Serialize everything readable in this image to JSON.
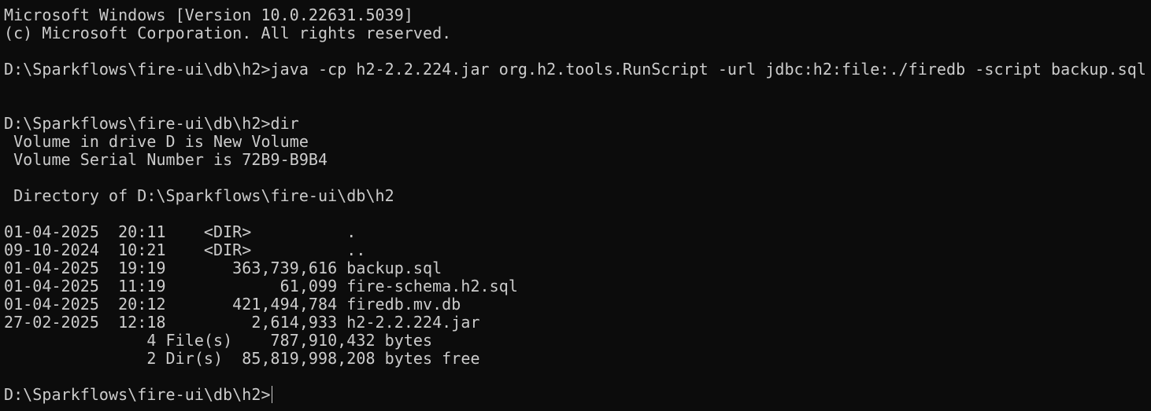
{
  "terminal": {
    "lines": [
      "Microsoft Windows [Version 10.0.22631.5039]",
      "(c) Microsoft Corporation. All rights reserved.",
      "",
      "D:\\Sparkflows\\fire-ui\\db\\h2>java -cp h2-2.2.224.jar org.h2.tools.RunScript -url jdbc:h2:file:./firedb -script backup.sql",
      "",
      "",
      "D:\\Sparkflows\\fire-ui\\db\\h2>dir",
      " Volume in drive D is New Volume",
      " Volume Serial Number is 72B9-B9B4",
      "",
      " Directory of D:\\Sparkflows\\fire-ui\\db\\h2",
      "",
      "01-04-2025  20:11    <DIR>          .",
      "09-10-2024  10:21    <DIR>          ..",
      "01-04-2025  19:19       363,739,616 backup.sql",
      "01-04-2025  11:19            61,099 fire-schema.h2.sql",
      "01-04-2025  20:12       421,494,784 firedb.mv.db",
      "27-02-2025  12:18         2,614,933 h2-2.2.224.jar",
      "               4 File(s)    787,910,432 bytes",
      "               2 Dir(s)  85,819,998,208 bytes free",
      ""
    ],
    "prompt": "D:\\Sparkflows\\fire-ui\\db\\h2>",
    "colors": {
      "background": "#0c0c0c",
      "foreground": "#cccccc"
    }
  }
}
